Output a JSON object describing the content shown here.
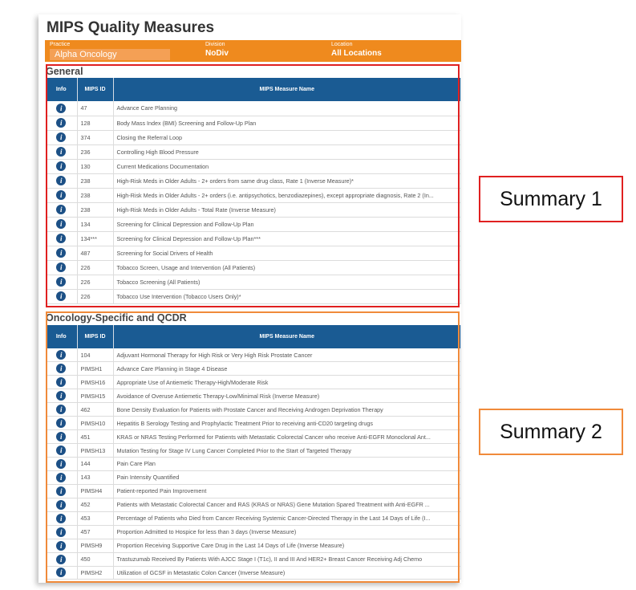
{
  "page_title": "MIPS Quality Measures",
  "filters": {
    "practice_label": "Practice",
    "practice_value": "Alpha Oncology",
    "division_label": "Division",
    "division_value": "NoDiv",
    "location_label": "Location",
    "location_value": "All Locations"
  },
  "columns": {
    "info": "Info",
    "mips_id": "MIPS ID",
    "name": "MIPS Measure Name"
  },
  "sections": {
    "general": {
      "title": "General",
      "rows": [
        {
          "id": "47",
          "name": "Advance Care Planning"
        },
        {
          "id": "128",
          "name": "Body Mass Index (BMI) Screening and Follow-Up Plan"
        },
        {
          "id": "374",
          "name": "Closing the Referral Loop"
        },
        {
          "id": "236",
          "name": "Controlling High Blood Pressure"
        },
        {
          "id": "130",
          "name": "Current Medications Documentation"
        },
        {
          "id": "238",
          "name": "High-Risk Meds in Older Adults - 2+ orders from same drug class, Rate 1 (Inverse Measure)*"
        },
        {
          "id": "238",
          "name": "High-Risk Meds in Older Adults - 2+ orders (i.e. antipsychotics, benzodiazepines), except appropriate diagnosis, Rate 2 (In..."
        },
        {
          "id": "238",
          "name": "High-Risk Meds in Older Adults - Total Rate (Inverse Measure)"
        },
        {
          "id": "134",
          "name": "Screening for Clinical Depression and Follow-Up Plan"
        },
        {
          "id": "134***",
          "name": "Screening for Clinical Depression and Follow-Up Plan***"
        },
        {
          "id": "487",
          "name": "Screening for Social Drivers of Health"
        },
        {
          "id": "226",
          "name": "Tobacco Screen, Usage and Intervention (All Patients)"
        },
        {
          "id": "226",
          "name": "Tobacco Screening (All Patients)"
        },
        {
          "id": "226",
          "name": "Tobacco Use Intervention (Tobacco Users Only)*"
        }
      ]
    },
    "oncology": {
      "title": "Oncology-Specific and QCDR",
      "rows": [
        {
          "id": "104",
          "name": "Adjuvant Hormonal Therapy for High Risk or Very High Risk Prostate Cancer"
        },
        {
          "id": "PIMSH1",
          "name": "Advance Care Planning in Stage 4 Disease"
        },
        {
          "id": "PIMSH16",
          "name": "Appropriate Use of Antiemetic Therapy-High/Moderate Risk"
        },
        {
          "id": "PIMSH15",
          "name": "Avoidance of Overuse Antiemetic Therapy-Low/Minimal Risk (Inverse Measure)"
        },
        {
          "id": "462",
          "name": "Bone Density Evaluation for Patients with Prostate Cancer and Receiving Androgen Deprivation Therapy"
        },
        {
          "id": "PIMSH10",
          "name": "Hepatitis B Serology Testing and Prophylactic Treatment Prior to receiving anti-CD20 targeting drugs"
        },
        {
          "id": "451",
          "name": "KRAS or NRAS Testing Performed for Patients with Metastatic Colorectal Cancer who receive Anti-EGFR Monoclonal Ant..."
        },
        {
          "id": "PIMSH13",
          "name": "Mutation Testing for Stage IV Lung Cancer Completed Prior to the Start of Targeted Therapy"
        },
        {
          "id": "144",
          "name": "Pain Care Plan"
        },
        {
          "id": "143",
          "name": "Pain Intensity Quantified"
        },
        {
          "id": "PIMSH4",
          "name": "Patient-reported Pain Improvement"
        },
        {
          "id": "452",
          "name": "Patients with Metastatic Colorectal Cancer and RAS (KRAS or NRAS) Gene Mutation Spared Treatment with Anti-EGFR ..."
        },
        {
          "id": "453",
          "name": "Percentage of Patients who Died from Cancer Receiving Systemic Cancer-Directed Therapy in the Last 14 Days of Life (I..."
        },
        {
          "id": "457",
          "name": "Proportion Admitted to Hospice for less than 3 days (Inverse Measure)"
        },
        {
          "id": "PIMSH9",
          "name": "Proportion Receiving Supportive Care Drug in the Last 14 Days of Life (Inverse Measure)"
        },
        {
          "id": "450",
          "name": "Trastuzumab Received By Patients With AJCC Stage I (T1c), II and III And HER2+ Breast Cancer Receiving Adj Chemo"
        },
        {
          "id": "PIMSH2",
          "name": "Utilization of GCSF in Metastatic Colon Cancer (Inverse Measure)"
        }
      ]
    }
  },
  "callouts": {
    "summary1": "Summary 1",
    "summary2": "Summary 2"
  },
  "icons": {
    "info": "info-icon"
  },
  "colors": {
    "header_orange": "#ef8a1e",
    "table_header_blue": "#1a5b93",
    "box1_red": "#e02020",
    "box2_orange": "#f08a3a"
  }
}
